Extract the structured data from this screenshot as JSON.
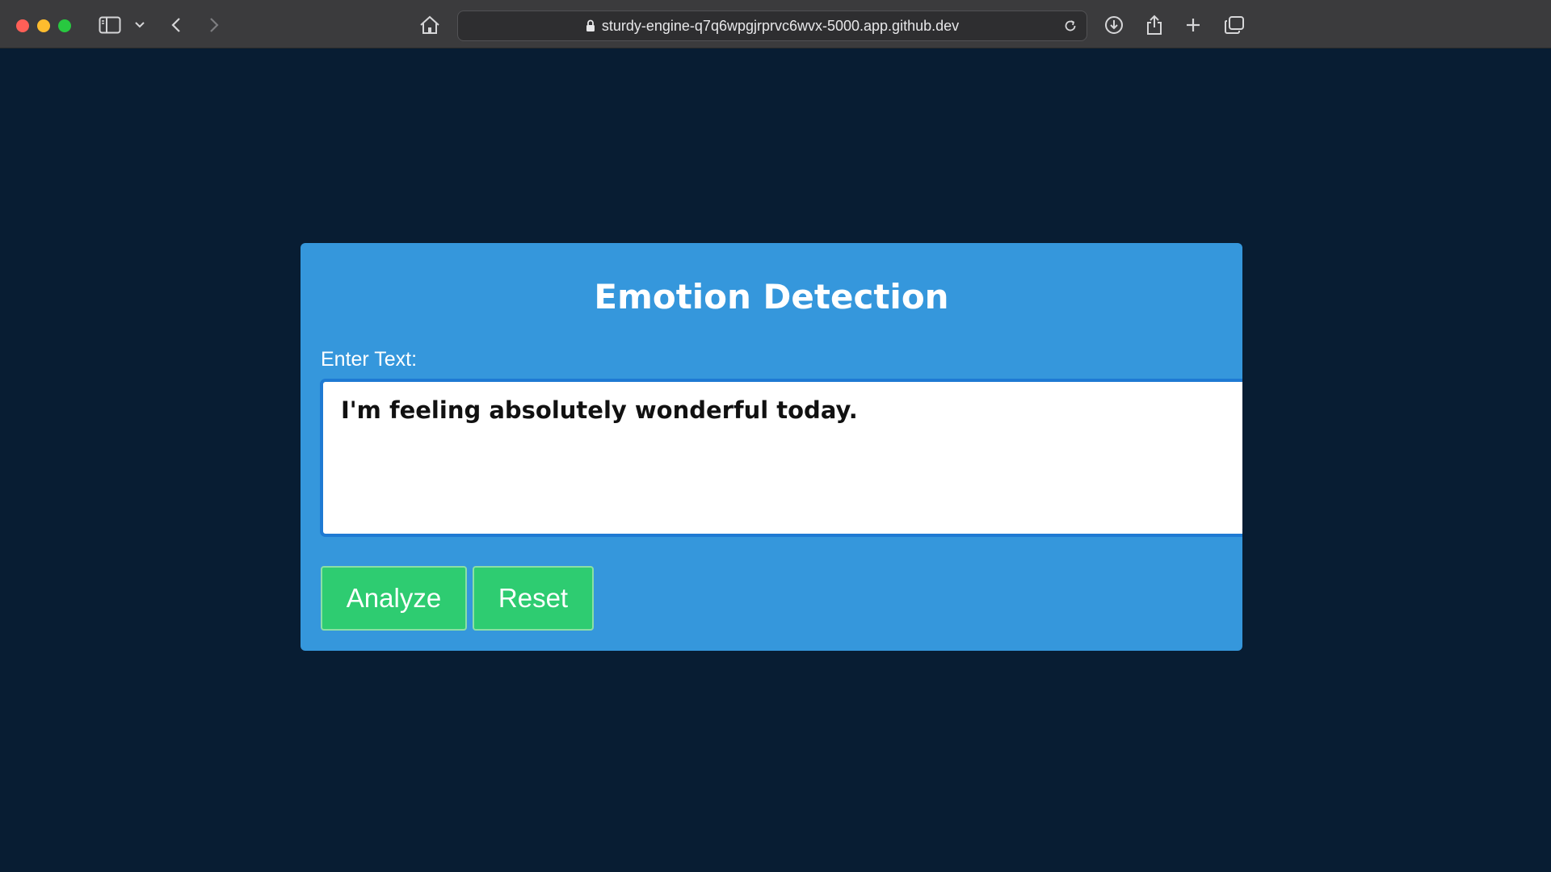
{
  "browser": {
    "url": "sturdy-engine-q7q6wpgjrprvc6wvx-5000.app.github.dev",
    "icons": {
      "sidebar": "sidebar-toggle-icon",
      "sidebar_menu": "chevron-down-icon",
      "back": "chevron-left-icon",
      "forward": "chevron-right-icon",
      "home": "home-icon",
      "lock": "lock-icon",
      "reload": "reload-icon",
      "download": "download-icon",
      "share": "share-icon",
      "new_tab": "plus-icon",
      "tab_overview": "tabs-overview-icon"
    }
  },
  "app": {
    "title": "Emotion Detection",
    "input_label": "Enter Text:",
    "input_value": "I'm feeling absolutely wonderful today.",
    "analyze_label": "Analyze",
    "reset_label": "Reset"
  },
  "colors": {
    "page_background": "#081d33",
    "card_background": "#3597dc",
    "button_background": "#2ecc71",
    "input_border": "#1e7ad3"
  }
}
